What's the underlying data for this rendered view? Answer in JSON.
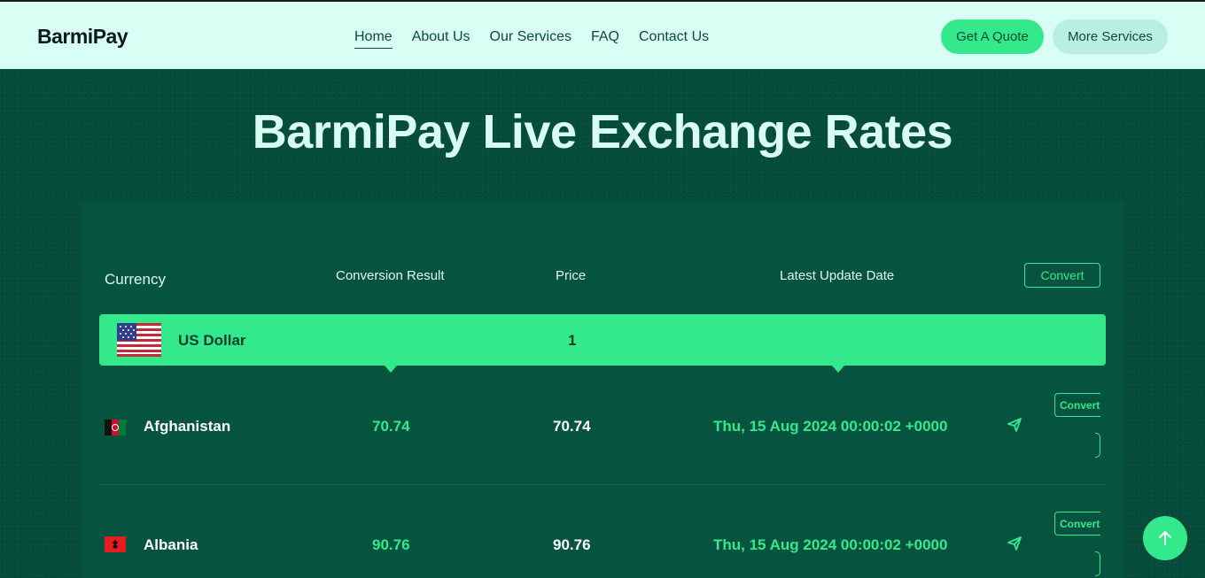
{
  "header": {
    "logo": "BarmiPay",
    "nav": [
      "Home",
      "About Us",
      "Our Services",
      "FAQ",
      "Contact Us"
    ],
    "quote_button": "Get A Quote",
    "more_button": "More Services"
  },
  "page_title": "BarmiPay Live Exchange Rates",
  "table": {
    "headers": {
      "currency": "Currency",
      "conversion_result": "Conversion Result",
      "price": "Price",
      "latest_update": "Latest Update Date",
      "convert": "Convert"
    },
    "base": {
      "name": "US Dollar",
      "value": "1",
      "flag_icon": "us-flag-icon"
    },
    "rows": [
      {
        "country": "Afghanistan",
        "conversion_result": "70.74",
        "price": "70.74",
        "date": "Thu, 15 Aug 2024 00:00:02 +0000",
        "convert_label": "Convert",
        "flag_icon": "afghanistan-flag-icon"
      },
      {
        "country": "Albania",
        "conversion_result": "90.76",
        "price": "90.76",
        "date": "Thu, 15 Aug 2024 00:00:02 +0000",
        "convert_label": "Convert",
        "flag_icon": "albania-flag-icon"
      }
    ]
  },
  "colors": {
    "background": "#064d3b",
    "header_bg": "#d8fff4",
    "accent": "#34e88c",
    "panel": "#065440"
  }
}
